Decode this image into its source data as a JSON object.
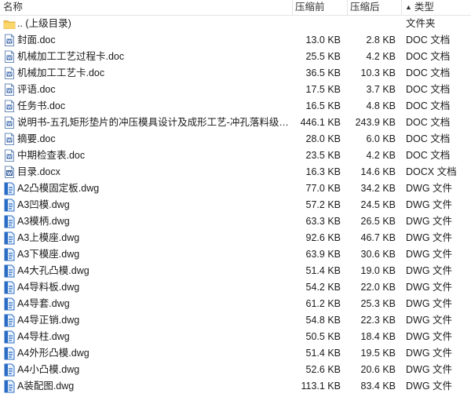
{
  "columns": {
    "name": "名称",
    "compressed": "压缩前",
    "original": "压缩后",
    "type": "类型",
    "sort_indicator": "▲"
  },
  "rows": [
    {
      "icon": "folder-icon",
      "name": ".. (上级目录)",
      "compressed": "",
      "original": "",
      "type": "文件夹"
    },
    {
      "icon": "doc-file-icon",
      "name": "封面.doc",
      "compressed": "13.0 KB",
      "original": "2.8 KB",
      "type": "DOC 文档"
    },
    {
      "icon": "doc-file-icon",
      "name": "机械加工工艺过程卡.doc",
      "compressed": "25.5 KB",
      "original": "4.2 KB",
      "type": "DOC 文档"
    },
    {
      "icon": "doc-file-icon",
      "name": "机械加工工艺卡.doc",
      "compressed": "36.5 KB",
      "original": "10.3 KB",
      "type": "DOC 文档"
    },
    {
      "icon": "doc-file-icon",
      "name": "评语.doc",
      "compressed": "17.5 KB",
      "original": "3.7 KB",
      "type": "DOC 文档"
    },
    {
      "icon": "doc-file-icon",
      "name": "任务书.doc",
      "compressed": "16.5 KB",
      "original": "4.8 KB",
      "type": "DOC 文档"
    },
    {
      "icon": "doc-file-icon",
      "name": "说明书-五孔矩形垫片的冲压模具设计及成形工艺-冲孔落料级进...",
      "compressed": "446.1 KB",
      "original": "243.9 KB",
      "type": "DOC 文档"
    },
    {
      "icon": "doc-file-icon",
      "name": "摘要.doc",
      "compressed": "28.0 KB",
      "original": "6.0 KB",
      "type": "DOC 文档"
    },
    {
      "icon": "doc-file-icon",
      "name": "中期检查表.doc",
      "compressed": "23.5 KB",
      "original": "4.2 KB",
      "type": "DOC 文档"
    },
    {
      "icon": "docx-file-icon",
      "name": "目录.docx",
      "compressed": "16.3 KB",
      "original": "14.6 KB",
      "type": "DOCX 文档"
    },
    {
      "icon": "dwg-file-icon",
      "name": "A2凸模固定板.dwg",
      "compressed": "77.0 KB",
      "original": "34.2 KB",
      "type": "DWG 文件"
    },
    {
      "icon": "dwg-file-icon",
      "name": "A3凹模.dwg",
      "compressed": "57.2 KB",
      "original": "24.5 KB",
      "type": "DWG 文件"
    },
    {
      "icon": "dwg-file-icon",
      "name": "A3模柄.dwg",
      "compressed": "63.3 KB",
      "original": "26.5 KB",
      "type": "DWG 文件"
    },
    {
      "icon": "dwg-file-icon",
      "name": "A3上模座.dwg",
      "compressed": "92.6 KB",
      "original": "46.7 KB",
      "type": "DWG 文件"
    },
    {
      "icon": "dwg-file-icon",
      "name": "A3下模座.dwg",
      "compressed": "63.9 KB",
      "original": "30.6 KB",
      "type": "DWG 文件"
    },
    {
      "icon": "dwg-file-icon",
      "name": "A4大孔凸模.dwg",
      "compressed": "51.4 KB",
      "original": "19.0 KB",
      "type": "DWG 文件"
    },
    {
      "icon": "dwg-file-icon",
      "name": "A4导料板.dwg",
      "compressed": "54.2 KB",
      "original": "22.0 KB",
      "type": "DWG 文件"
    },
    {
      "icon": "dwg-file-icon",
      "name": "A4导套.dwg",
      "compressed": "61.2 KB",
      "original": "25.3 KB",
      "type": "DWG 文件"
    },
    {
      "icon": "dwg-file-icon",
      "name": "A4导正销.dwg",
      "compressed": "54.8 KB",
      "original": "22.3 KB",
      "type": "DWG 文件"
    },
    {
      "icon": "dwg-file-icon",
      "name": "A4导柱.dwg",
      "compressed": "50.5 KB",
      "original": "18.4 KB",
      "type": "DWG 文件"
    },
    {
      "icon": "dwg-file-icon",
      "name": "A4外形凸模.dwg",
      "compressed": "51.4 KB",
      "original": "19.5 KB",
      "type": "DWG 文件"
    },
    {
      "icon": "dwg-file-icon",
      "name": "A4小凸模.dwg",
      "compressed": "52.6 KB",
      "original": "20.6 KB",
      "type": "DWG 文件"
    },
    {
      "icon": "dwg-file-icon",
      "name": "A装配图.dwg",
      "compressed": "113.1 KB",
      "original": "83.4 KB",
      "type": "DWG 文件"
    }
  ]
}
